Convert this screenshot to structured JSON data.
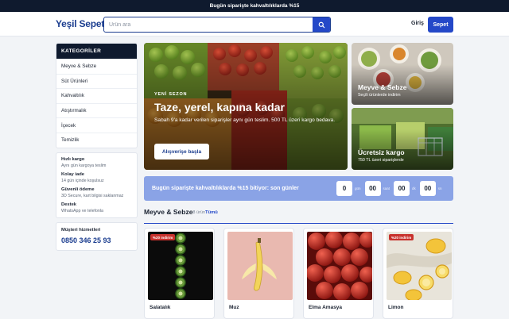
{
  "announcement": "Bugün siparişte kahvaltılıklarda %15",
  "header": {
    "logo": "Yeşil Sepet",
    "search_placeholder": "Ürün ara",
    "login": "Giriş",
    "cart": "Sepet"
  },
  "sidebar": {
    "heading": "KATEGORİLER",
    "categories": [
      "Meyve & Sebze",
      "Süt Ürünleri",
      "Kahvaltılık",
      "Atıştırmalık",
      "İçecek",
      "Temizlik"
    ],
    "info": [
      {
        "title": "Hızlı kargo",
        "sub": "Aynı gün kargoya teslim"
      },
      {
        "title": "Kolay iade",
        "sub": "14 gün içinde koşulsuz"
      },
      {
        "title": "Güvenli ödeme",
        "sub": "3D Secure, kart bilgisi saklanmaz"
      },
      {
        "title": "Destek",
        "sub": "WhatsApp ve telefonla"
      }
    ],
    "support": {
      "label": "Müşteri hizmetleri",
      "phone": "0850 346 25 93"
    }
  },
  "hero": {
    "eyebrow": "YENİ SEZON",
    "title": "Taze, yerel, kapına kadar",
    "desc": "Sabah 9'a kadar verilen siparişler aynı gün teslim. 500 TL üzeri kargo bedava.",
    "button": "Alışverişe başla"
  },
  "promos": [
    {
      "title": "Meyve & Sebze",
      "sub": "Seçili ürünlerde indirim"
    },
    {
      "title": "Ücretsiz kargo",
      "sub": "750 TL üzeri siparişlerde"
    }
  ],
  "countdown": {
    "text": "Bugün siparişte kahvaltılıklarda %15 bitiyor: son günler",
    "units": [
      {
        "value": "0",
        "label": "gün"
      },
      {
        "value": "00",
        "label": "saat"
      },
      {
        "value": "00",
        "label": "dk"
      },
      {
        "value": "00",
        "label": "sn"
      }
    ]
  },
  "section": {
    "title": "Meyve & Sebze",
    "count": "8 ürün",
    "all": "Tümü"
  },
  "products": [
    {
      "name": "Salatalık",
      "badge": "%20 indirim"
    },
    {
      "name": "Muz",
      "badge": ""
    },
    {
      "name": "Elma Amasya",
      "badge": ""
    },
    {
      "name": "Limon",
      "badge": "%20 indirim"
    }
  ],
  "colors": {
    "brand": "#1b3d8f",
    "accent": "#2448c8",
    "dark": "#0f1a2e",
    "discount": "#c8322d"
  }
}
